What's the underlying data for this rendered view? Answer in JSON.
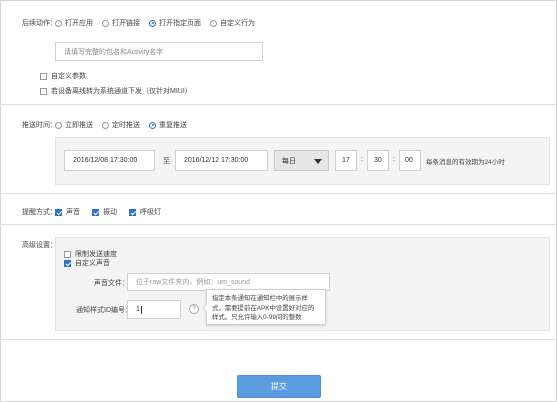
{
  "after_action": {
    "label": "后续动作：",
    "options": [
      "打开应用",
      "打开链接",
      "打开指定页面",
      "自定义行为"
    ],
    "selected_index": 2,
    "page_placeholder": "请填写完整的包名和Activity名字",
    "custom_params_label": "自定义参数",
    "system_channel_label": "若设备离线转为系统通道下发（仅针对MIUI）"
  },
  "push_time": {
    "label": "推送时间：",
    "options": [
      "立即推送",
      "定时推送",
      "重复推送"
    ],
    "selected_index": 2,
    "start_date": "2016/12/08 17:30:00",
    "to_label": "至",
    "end_date": "2016/12/12 17:30:00",
    "repeat_select": "每日",
    "hour": "17",
    "minute": "30",
    "second": "00",
    "colon": ":",
    "note": "每条消息的有效期为24小时"
  },
  "reminder": {
    "label": "提醒方式：",
    "options": [
      {
        "label": "声音",
        "checked": true
      },
      {
        "label": "振动",
        "checked": true
      },
      {
        "label": "呼吸灯",
        "checked": true
      }
    ]
  },
  "advanced": {
    "label": "高级设置：",
    "limit_speed_label": "限制发送速度",
    "limit_speed_checked": false,
    "custom_sound_label": "自定义声音",
    "custom_sound_checked": true,
    "sound_file_label": "声音文件：",
    "sound_file_placeholder": "位于raw文件夹内，例如：um_sound",
    "notify_style_label": "通知样式ID编号：",
    "notify_style_value": "1",
    "help_glyph": "?",
    "tooltip_text": "指定本条通知在通知栏中的展示样式，需要提前在APK中设置好对应的样式。只允许输入0-99间的整数"
  },
  "submit": {
    "label": "提交"
  },
  "colors": {
    "accent": "#2a73c9",
    "button": "#5b9be0",
    "panel": "#f4f4f4"
  }
}
